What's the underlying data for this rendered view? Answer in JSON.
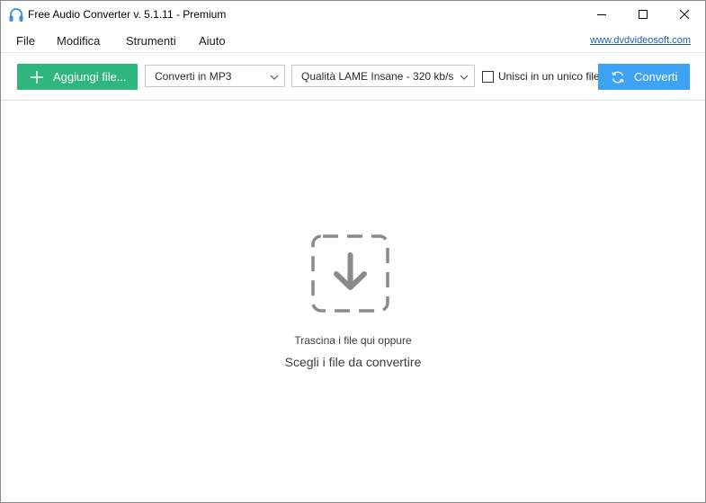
{
  "window": {
    "title": "Free Audio Converter v. 5.1.11 - Premium"
  },
  "menu": {
    "items": [
      "File",
      "Modifica",
      "Strumenti",
      "Aiuto"
    ],
    "website_link": "www.dvdvideosoft.com"
  },
  "toolbar": {
    "add_files_label": "Aggiungi file...",
    "format_selected": "Converti in MP3",
    "quality_selected": "Qualità LAME Insane - 320 kb/s",
    "merge_label": "Unisci in un unico file",
    "merge_checked": false,
    "convert_label": "Converti"
  },
  "dropzone": {
    "line1": "Trascina i file qui oppure",
    "line2": "Scegli i file da convertire"
  },
  "colors": {
    "add_button": "#2fb67c",
    "convert_button": "#3ea3f5",
    "link": "#1a5fb4",
    "drop_icon": "#8a8a8a"
  },
  "icons": {
    "app": "headphones-icon",
    "minimize": "minimize-icon",
    "maximize": "maximize-icon",
    "close": "close-icon",
    "add": "plus-icon",
    "dropdown": "chevron-down-icon",
    "convert": "sync-icon",
    "drop": "download-arrow-icon"
  }
}
